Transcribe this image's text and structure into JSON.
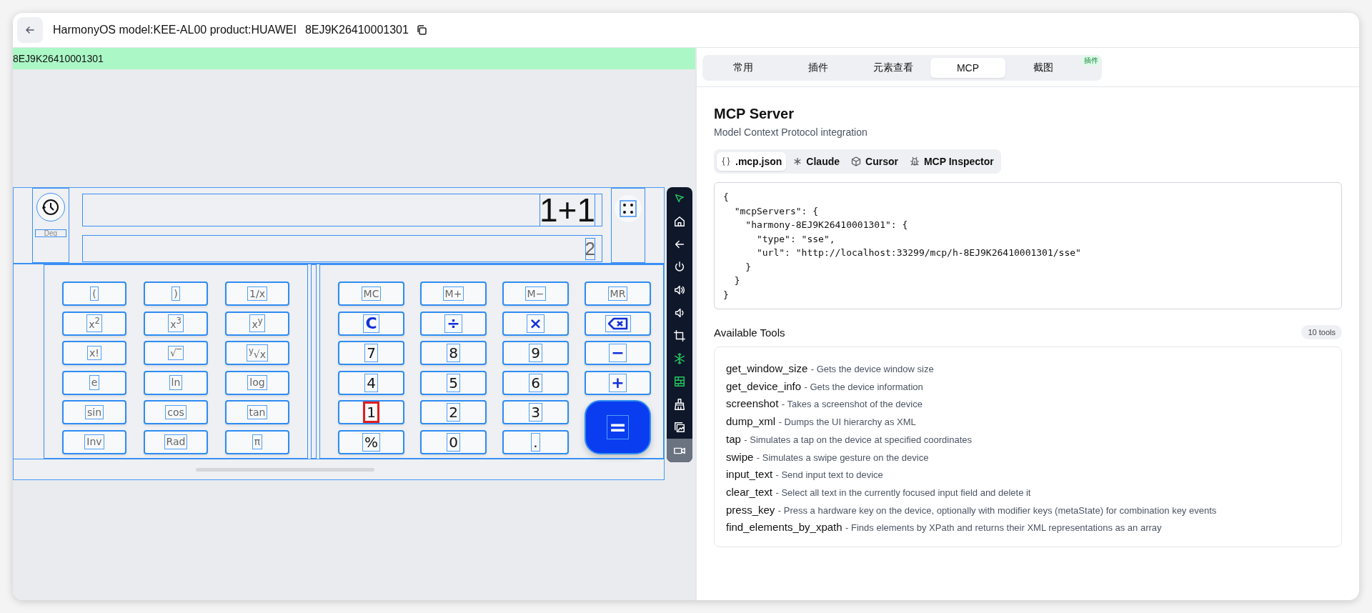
{
  "header": {
    "title": "HarmonyOS model:KEE-AL00 product:HUAWEI",
    "serial": "8EJ9K26410001301"
  },
  "device_bar": {
    "label": "8EJ9K26410001301"
  },
  "calculator": {
    "mode": "Deg",
    "expression": "1+1",
    "result": "2",
    "scientific_keys": [
      "(",
      ")",
      "1/x",
      "x$^{2}$",
      "x$^{3}$",
      "x$^{y}$",
      "x!",
      "√‾",
      "$^{y}$√x",
      "e",
      "ln",
      "log",
      "sin",
      "cos",
      "tan",
      "Inv",
      "Rad",
      "π"
    ],
    "keys": [
      {
        "kind": "memory",
        "label": "MC",
        "highlighted": false
      },
      {
        "kind": "memory",
        "label": "M+",
        "highlighted": false
      },
      {
        "kind": "memory",
        "label": "M−",
        "highlighted": false
      },
      {
        "kind": "memory",
        "label": "MR",
        "highlighted": false
      },
      {
        "kind": "operator",
        "label": "C",
        "highlighted": false
      },
      {
        "kind": "operator",
        "label": "÷",
        "highlighted": false
      },
      {
        "kind": "operator",
        "label": "×",
        "highlighted": false
      },
      {
        "kind": "backspace",
        "highlighted": false
      },
      {
        "kind": "digit",
        "label": "7",
        "highlighted": false
      },
      {
        "kind": "digit",
        "label": "8",
        "highlighted": false
      },
      {
        "kind": "digit",
        "label": "9",
        "highlighted": false
      },
      {
        "kind": "operator",
        "label": "−",
        "highlighted": false
      },
      {
        "kind": "digit",
        "label": "4",
        "highlighted": false
      },
      {
        "kind": "digit",
        "label": "5",
        "highlighted": false
      },
      {
        "kind": "digit",
        "label": "6",
        "highlighted": false
      },
      {
        "kind": "operator",
        "label": "+",
        "highlighted": false
      },
      {
        "kind": "digit",
        "label": "1",
        "highlighted": true
      },
      {
        "kind": "digit",
        "label": "2",
        "highlighted": false
      },
      {
        "kind": "digit",
        "label": "3",
        "highlighted": false
      },
      {
        "kind": "equals",
        "label": "=",
        "highlighted": false
      },
      {
        "kind": "digit",
        "label": "%",
        "highlighted": false
      },
      {
        "kind": "digit",
        "label": "0",
        "highlighted": false
      },
      {
        "kind": "digit",
        "label": ".",
        "highlighted": false
      }
    ]
  },
  "toolbar": [
    {
      "kind": "pointer",
      "active": true,
      "selected": false
    },
    {
      "kind": "home",
      "active": false,
      "selected": false
    },
    {
      "kind": "back",
      "active": false,
      "selected": false
    },
    {
      "kind": "power",
      "active": false,
      "selected": false
    },
    {
      "kind": "volume-up",
      "active": false,
      "selected": false
    },
    {
      "kind": "volume-down",
      "active": false,
      "selected": false
    },
    {
      "kind": "crop",
      "active": false,
      "selected": false
    },
    {
      "kind": "snowflake",
      "active": true,
      "selected": false
    },
    {
      "kind": "grid",
      "active": true,
      "selected": false
    },
    {
      "kind": "broom",
      "active": false,
      "selected": false
    },
    {
      "kind": "images",
      "active": false,
      "selected": false
    },
    {
      "kind": "video",
      "active": false,
      "selected": true
    }
  ],
  "panel": {
    "tabs": [
      {
        "label": "常用",
        "selected": false
      },
      {
        "label": "插件",
        "selected": false
      },
      {
        "label": "元素查看",
        "selected": false
      },
      {
        "label": "MCP",
        "selected": true
      },
      {
        "label": "截图",
        "selected": false,
        "badge": "插件"
      }
    ],
    "title": "MCP Server",
    "subtitle": "Model Context Protocol integration",
    "config_tabs": [
      {
        "kind": "braces",
        "label": ".mcp.json",
        "selected": true
      },
      {
        "kind": "asterisk",
        "label": "Claude",
        "selected": false
      },
      {
        "kind": "cube",
        "label": "Cursor",
        "selected": false
      },
      {
        "kind": "bug",
        "label": "MCP Inspector",
        "selected": false
      }
    ],
    "config": "{\n  \"mcpServers\": {\n    \"harmony-8EJ9K26410001301\": {\n      \"type\": \"sse\",\n      \"url\": \"http://localhost:33299/mcp/h-8EJ9K26410001301/sse\"\n    }\n  }\n}",
    "tools_heading": "Available Tools",
    "tools_count": "10 tools",
    "tools": [
      {
        "name": "get_window_size",
        "description": "- Gets the device window size"
      },
      {
        "name": "get_device_info",
        "description": "- Gets the device information"
      },
      {
        "name": "screenshot",
        "description": "- Takes a screenshot of the device"
      },
      {
        "name": "dump_xml",
        "description": "- Dumps the UI hierarchy as XML"
      },
      {
        "name": "tap",
        "description": "- Simulates a tap on the device at specified coordinates"
      },
      {
        "name": "swipe",
        "description": "- Simulates a swipe gesture on the device"
      },
      {
        "name": "input_text",
        "description": "- Send input text to device"
      },
      {
        "name": "clear_text",
        "description": "- Select all text in the currently focused input field and delete it"
      },
      {
        "name": "press_key",
        "description": "- Press a hardware key on the device, optionally with modifier keys (metaState) for combination key events"
      },
      {
        "name": "find_elements_by_xpath",
        "description": "- Finds elements by XPath and returns their XML representations as an array"
      }
    ]
  }
}
